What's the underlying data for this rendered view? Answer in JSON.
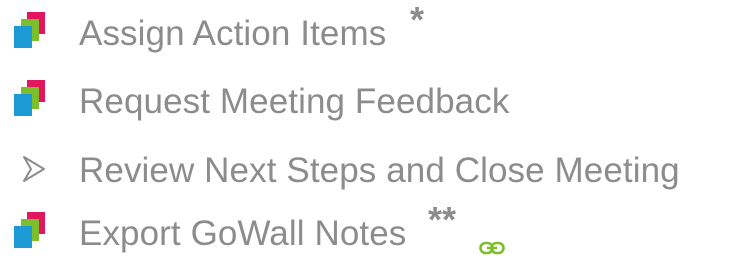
{
  "items": [
    {
      "label": "Assign Action Items",
      "suffix": "*",
      "bullet": "layered-squares-icon"
    },
    {
      "label": "Request Meeting Feedback",
      "bullet": "layered-squares-icon"
    },
    {
      "label": "Review Next Steps and Close Meeting",
      "bullet": "arrow-bullet-icon"
    },
    {
      "label": "Export GoWall Notes",
      "suffix": "**",
      "bullet": "layered-squares-icon",
      "trailing_icon": "link-icon"
    }
  ],
  "colors": {
    "text": "#8c8c8c",
    "square_red": "#e2165e",
    "square_green": "#7dbf2a",
    "square_blue": "#1b9ad6",
    "link": "#7dbf2a"
  }
}
